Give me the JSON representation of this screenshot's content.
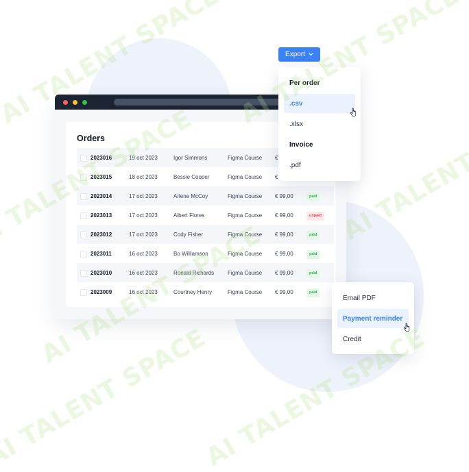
{
  "watermark": {
    "text": "AI TALENT SPACE",
    "color": "#b6e08a"
  },
  "window": {
    "controls": [
      "close",
      "minimize",
      "maximize"
    ]
  },
  "orders": {
    "title": "Orders",
    "rows": [
      {
        "id": "2023016",
        "date": "19 oct 2023",
        "name": "Igor Simmons",
        "course": "Figma Course",
        "price": "€",
        "status": ""
      },
      {
        "id": "2023015",
        "date": "18 oct 2023",
        "name": "Bessie Cooper",
        "course": "Figma Course",
        "price": "€",
        "status": ""
      },
      {
        "id": "2023014",
        "date": "17 oct 2023",
        "name": "Arlene McCoy",
        "course": "Figma Course",
        "price": "€ 99,00",
        "status": "paid"
      },
      {
        "id": "2023013",
        "date": "17 oct 2023",
        "name": "Albert Flores",
        "course": "Figma Course",
        "price": "€ 99,00",
        "status": "unpaid"
      },
      {
        "id": "2023012",
        "date": "17 oct 2023",
        "name": "Cody Fisher",
        "course": "Figma Course",
        "price": "€ 99,00",
        "status": "paid"
      },
      {
        "id": "2023011",
        "date": "16 oct 2023",
        "name": "Bo Williamson",
        "course": "Figma Course",
        "price": "€ 99,00",
        "status": "paid"
      },
      {
        "id": "2023010",
        "date": "16 oct 2023",
        "name": "Ronald Richards",
        "course": "Figma Course",
        "price": "€ 99,00",
        "status": "paid"
      },
      {
        "id": "2023009",
        "date": "16 oct 2023",
        "name": "Courtney Henry",
        "course": "Figma Course",
        "price": "€ 99,00",
        "status": "paid"
      }
    ]
  },
  "export": {
    "button_label": "Export",
    "icon": "chevron-down-icon",
    "menu": [
      {
        "label": "Per order",
        "kind": "header"
      },
      {
        "label": ".csv",
        "kind": "item",
        "selected": true
      },
      {
        "label": ".xlsx",
        "kind": "item"
      },
      {
        "label": "Invoice",
        "kind": "header"
      },
      {
        "label": ".pdf",
        "kind": "item"
      }
    ]
  },
  "reminder_menu": {
    "items": [
      {
        "label": "Email PDF"
      },
      {
        "label": "Payment reminder",
        "selected": true
      },
      {
        "label": "Credit"
      }
    ]
  },
  "colors": {
    "accent": "#3b82f6",
    "paid": "#2bb24c",
    "unpaid": "#e4414e",
    "titlebar": "#1c2434"
  }
}
